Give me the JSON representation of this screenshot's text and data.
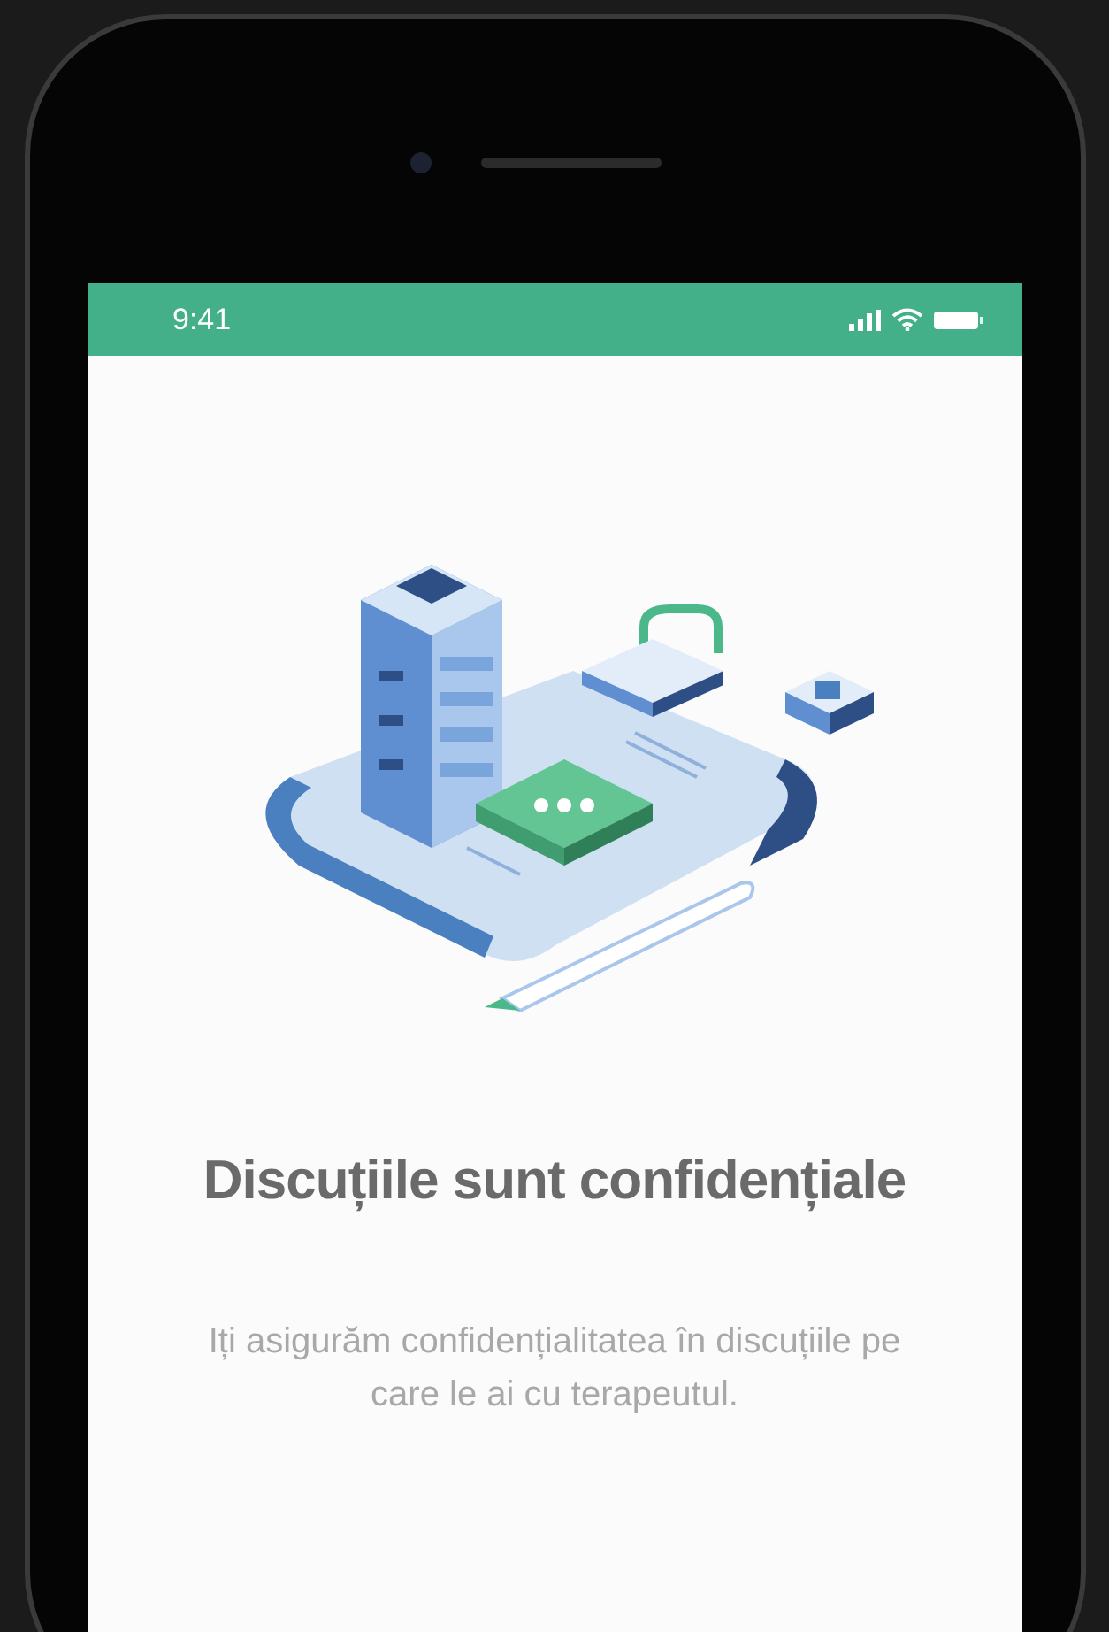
{
  "status_bar": {
    "time": "9:41"
  },
  "onboarding": {
    "title": "Discuțiile sunt confidențiale",
    "description": "Iți asigurăm confidențialitatea în discuțiile pe care le ai cu terapeutul."
  }
}
